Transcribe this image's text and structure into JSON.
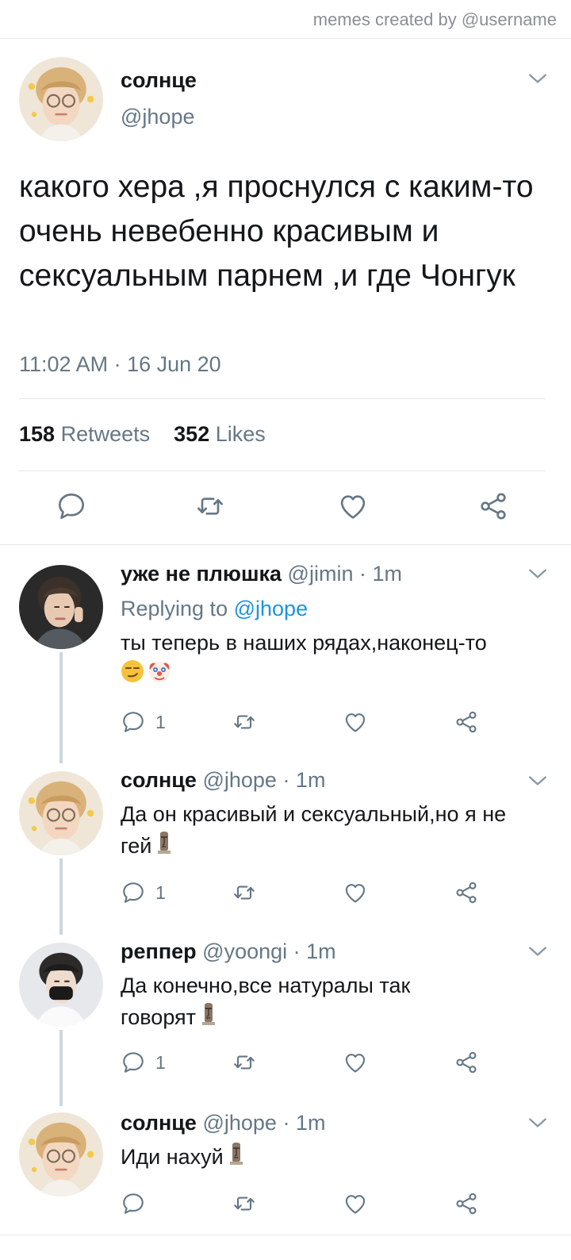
{
  "watermark": "memes created by @username",
  "main_tweet": {
    "name": "солнце",
    "handle": "@jhope",
    "text": "какого хера ,я проснулся с каким-то очень невебенно красивым и сексуальным парнем ,и где Чонгук",
    "timestamp": "11:02 AM · 16 Jun 20",
    "retweets_count": "158",
    "retweets_label": "Retweets",
    "likes_count": "352",
    "likes_label": "Likes"
  },
  "replies": [
    {
      "name": "уже не плюшка",
      "handle": "@jimin",
      "time": "· 1m",
      "replying_prefix": "Replying to",
      "replying_handle": "@jhope",
      "text": "ты теперь в наших рядах,наконец-то",
      "emoji": [
        "smirk-emoji",
        "clown-emoji"
      ],
      "reply_count": "1"
    },
    {
      "name": "солнце",
      "handle": "@jhope",
      "time": "· 1m",
      "text": "Да он красивый и сексуальный,но я не гей",
      "emoji": [
        "moai-emoji"
      ],
      "reply_count": "1"
    },
    {
      "name": "реппер",
      "handle": "@yoongi",
      "time": "· 1m",
      "text": "Да конечно,все натуралы так говорят",
      "emoji": [
        "moai-emoji"
      ],
      "reply_count": "1"
    },
    {
      "name": "солнце",
      "handle": "@jhope",
      "time": "· 1m",
      "text": "Иди нахуй",
      "emoji": [
        "moai-emoji"
      ],
      "reply_count": ""
    }
  ],
  "colors": {
    "text": "#14171a",
    "secondary": "#657786",
    "link": "#1b95e0",
    "divider": "#e1e8ed",
    "thread_line": "#ccd6dd"
  },
  "icons": [
    "chevron-down-icon",
    "reply-icon",
    "retweet-icon",
    "like-icon",
    "share-icon"
  ]
}
